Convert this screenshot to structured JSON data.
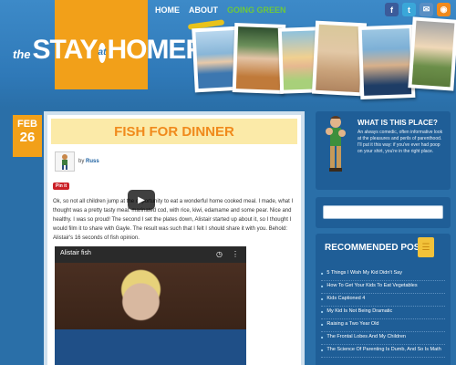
{
  "header": {
    "logo": {
      "the": "the",
      "stay": "STAY",
      "at": "at",
      "homer": "HOMER"
    },
    "nav": [
      {
        "label": "HOME"
      },
      {
        "label": "ABOUT"
      },
      {
        "label": "GOING GREEN"
      }
    ],
    "social": [
      "f",
      "t",
      "✉",
      "◉"
    ]
  },
  "post": {
    "date_month": "FEB",
    "date_day": "26",
    "title": "FISH FOR DINNER",
    "by_label": "by",
    "author": "Russ",
    "pin_label": "Pin it",
    "body": "Ok, so not all children jump at the opportunity to eat a wonderful home cooked meal. I made, what I thought was a pretty tasty meal: marinated cod, with rice, kiwi, edamame and some pear. Nice and healthy. I was so proud! The second I set the plates down, Alistair started up about it, so I thought I would film it to share with Gayle. The result was such that I felt I should share it with you. Behold: Alistair's 16 seconds of fish opinion.",
    "video_title": "Alistair fish"
  },
  "sidebar": {
    "about_title": "WHAT IS THIS PLACE?",
    "about_desc": "An always comedic, often informative look at the pleasures and perils of parenthood. I'll put it this way: if you've ever had poop on your shirt, you're in the right place.",
    "search_placeholder": "",
    "recommended_title": "RECOMMENDED POSTS",
    "recommended": [
      "5 Things I Wish My Kid Didn't Say",
      "How To Get Your Kids To Eat Vegetables",
      "Kids Captioned 4",
      "My Kid Is Not Being Dramatic",
      "Raising a Two Year Old",
      "The Frontal Lobes And My Children",
      "The Science Of Parenting Is Dumb, And So Is Math"
    ]
  },
  "colors": {
    "background": "#2a6fa8",
    "accent_orange": "#f2a019",
    "title_orange": "#f08a1c",
    "nav_green": "#6ec83c",
    "sidebar_blue": "#1f5e97"
  }
}
